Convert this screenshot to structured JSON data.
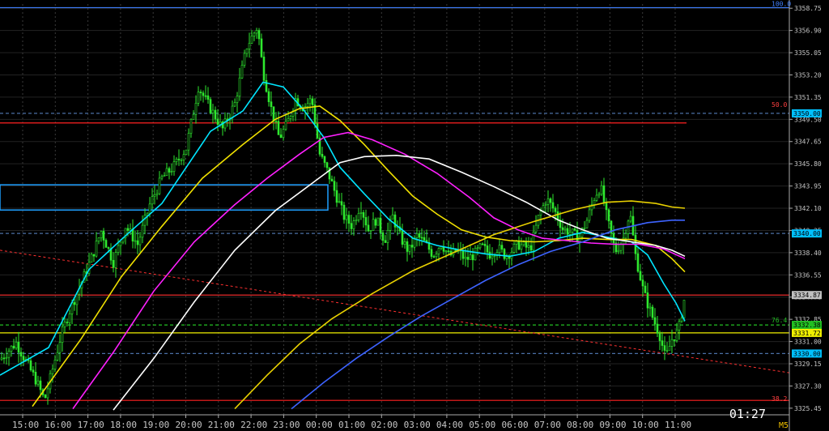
{
  "chart_data": {
    "type": "candlestick-line",
    "title": "",
    "timeframe": "M5",
    "countdown": "01:27",
    "y_ticks": [
      "3358.75",
      "3356.90",
      "3355.05",
      "3353.20",
      "3351.35",
      "3349.50",
      "3347.65",
      "3345.80",
      "3343.95",
      "3342.10",
      "3340.25",
      "3338.40",
      "3336.55",
      "3334.70",
      "3332.85",
      "3331.00",
      "3329.15",
      "3327.30",
      "3325.45"
    ],
    "x_ticks": [
      "15:00",
      "16:00",
      "17:00",
      "18:00",
      "19:00",
      "20:00",
      "21:00",
      "22:00",
      "23:00",
      "00:00",
      "01:00",
      "02:00",
      "03:00",
      "04:00",
      "05:00",
      "06:00",
      "07:00",
      "08:00",
      "09:00",
      "10:00",
      "11:00"
    ],
    "ylim": [
      3324.9,
      3359.1
    ],
    "price_tags": [
      {
        "text": "3350.00",
        "price": 3350.0,
        "bg": "#00c0ff",
        "fg": "#000000"
      },
      {
        "text": "3340.00",
        "price": 3340.0,
        "bg": "#00c0ff",
        "fg": "#000000"
      },
      {
        "text": "3334.87",
        "price": 3334.87,
        "bg": "#c0c0c0",
        "fg": "#000000"
      },
      {
        "text": "3332.38",
        "price": 3332.38,
        "bg": "#22c022",
        "fg": "#000000"
      },
      {
        "text": "3331.72",
        "price": 3331.72,
        "bg": "#f0f000",
        "fg": "#000000"
      },
      {
        "text": "3330.00",
        "price": 3330.0,
        "bg": "#00c0ff",
        "fg": "#000000"
      }
    ],
    "fib_labels": [
      {
        "text": "100.0",
        "price": 3358.8,
        "color": "#4080ff"
      },
      {
        "text": "50.0",
        "price": 3350.4,
        "color": "#ff4040"
      },
      {
        "text": "76.4",
        "price": 3332.45,
        "color": "#22c022"
      },
      {
        "text": "38.2",
        "price": 3325.9,
        "color": "#ff4040"
      }
    ],
    "levels": [
      {
        "price": 3358.8,
        "color": "#4080ff",
        "style": "solid",
        "x1": 0,
        "x2": 975
      },
      {
        "price": 3350.0,
        "color": "#4a6fa5",
        "style": "dash",
        "x1": 0,
        "x2": 975
      },
      {
        "price": 3349.2,
        "color": "#ff2020",
        "style": "solid",
        "x1": 0,
        "x2": 848
      },
      {
        "price": 3340.0,
        "color": "#4a6fa5",
        "style": "dash",
        "x1": 0,
        "x2": 975
      },
      {
        "price": 3334.87,
        "color": "#ff3030",
        "style": "solid",
        "x1": 0,
        "x2": 975
      },
      {
        "price": 3332.38,
        "color": "#22c022",
        "style": "dash",
        "x1": 0,
        "x2": 975
      },
      {
        "price": 3331.72,
        "color": "#f0f000",
        "style": "solid",
        "x1": 0,
        "x2": 975
      },
      {
        "price": 3330.0,
        "color": "#4a6fa5",
        "style": "dash",
        "x1": 0,
        "x2": 975
      },
      {
        "price": 3326.1,
        "color": "#ff2020",
        "style": "solid",
        "x1": 0,
        "x2": 975
      }
    ],
    "zones": [
      {
        "top": 3344.05,
        "bottom": 3341.95,
        "x2": 405,
        "color": "#1ea0ff"
      }
    ],
    "series": [
      {
        "color": "#00e5ff",
        "points": [
          [
            0,
            3328.2
          ],
          [
            60,
            3330.5
          ],
          [
            110,
            3337
          ],
          [
            150,
            3339.5
          ],
          [
            200,
            3342.5
          ],
          [
            260,
            3348.5
          ],
          [
            300,
            3350.2
          ],
          [
            325,
            3352.6
          ],
          [
            350,
            3352.2
          ],
          [
            375,
            3350.3
          ],
          [
            400,
            3348
          ],
          [
            420,
            3345.5
          ],
          [
            450,
            3343.3
          ],
          [
            480,
            3341.2
          ],
          [
            510,
            3339.6
          ],
          [
            540,
            3339
          ],
          [
            570,
            3338.6
          ],
          [
            600,
            3338.3
          ],
          [
            630,
            3338.1
          ],
          [
            660,
            3338.5
          ],
          [
            690,
            3339.6
          ],
          [
            720,
            3340.1
          ],
          [
            750,
            3339.7
          ],
          [
            780,
            3339.3
          ],
          [
            800,
            3338.2
          ],
          [
            820,
            3335.8
          ],
          [
            835,
            3334.2
          ],
          [
            846,
            3332.7
          ]
        ]
      },
      {
        "color": "#f0e000",
        "points": [
          [
            40,
            3325.6
          ],
          [
            100,
            3331.2
          ],
          [
            150,
            3336.4
          ],
          [
            200,
            3340.6
          ],
          [
            250,
            3344.6
          ],
          [
            300,
            3347.4
          ],
          [
            340,
            3349.5
          ],
          [
            370,
            3350.4
          ],
          [
            395,
            3350.6
          ],
          [
            420,
            3349.4
          ],
          [
            450,
            3347.4
          ],
          [
            480,
            3345.2
          ],
          [
            510,
            3343.1
          ],
          [
            540,
            3341.6
          ],
          [
            570,
            3340.3
          ],
          [
            600,
            3339.7
          ],
          [
            630,
            3339.4
          ],
          [
            660,
            3339.3
          ],
          [
            690,
            3339.4
          ],
          [
            720,
            3339.6
          ],
          [
            750,
            3339.5
          ],
          [
            780,
            3339.5
          ],
          [
            810,
            3339
          ],
          [
            830,
            3337.9
          ],
          [
            846,
            3336.8
          ]
        ]
      },
      {
        "color": "#ff20ff",
        "points": [
          [
            90,
            3325.4
          ],
          [
            140,
            3330.1
          ],
          [
            190,
            3335.2
          ],
          [
            240,
            3339.3
          ],
          [
            290,
            3342.4
          ],
          [
            330,
            3344.6
          ],
          [
            370,
            3346.6
          ],
          [
            400,
            3348
          ],
          [
            430,
            3348.4
          ],
          [
            460,
            3347.8
          ],
          [
            500,
            3346.6
          ],
          [
            540,
            3345
          ],
          [
            580,
            3343
          ],
          [
            610,
            3341.3
          ],
          [
            640,
            3340.3
          ],
          [
            670,
            3339.6
          ],
          [
            700,
            3339.4
          ],
          [
            730,
            3339.2
          ],
          [
            760,
            3339.1
          ],
          [
            790,
            3339.1
          ],
          [
            820,
            3338.7
          ],
          [
            846,
            3337.9
          ]
        ]
      },
      {
        "color": "#ffffff",
        "points": [
          [
            140,
            3325.3
          ],
          [
            190,
            3329.6
          ],
          [
            240,
            3334.3
          ],
          [
            290,
            3338.6
          ],
          [
            340,
            3341.9
          ],
          [
            390,
            3344.4
          ],
          [
            420,
            3345.9
          ],
          [
            450,
            3346.4
          ],
          [
            490,
            3346.5
          ],
          [
            530,
            3346.2
          ],
          [
            570,
            3345.1
          ],
          [
            610,
            3343.9
          ],
          [
            650,
            3342.6
          ],
          [
            690,
            3341.1
          ],
          [
            720,
            3340.3
          ],
          [
            750,
            3339.6
          ],
          [
            780,
            3339.3
          ],
          [
            810,
            3339
          ],
          [
            830,
            3338.6
          ],
          [
            846,
            3338.1
          ]
        ]
      },
      {
        "color": "#e8d000",
        "points": [
          [
            290,
            3325.4
          ],
          [
            330,
            3328.2
          ],
          [
            370,
            3330.8
          ],
          [
            410,
            3332.9
          ],
          [
            460,
            3335
          ],
          [
            510,
            3336.9
          ],
          [
            560,
            3338.4
          ],
          [
            610,
            3339.9
          ],
          [
            660,
            3341
          ],
          [
            710,
            3342
          ],
          [
            750,
            3342.6
          ],
          [
            780,
            3342.7
          ],
          [
            810,
            3342.5
          ],
          [
            830,
            3342.2
          ],
          [
            846,
            3342.1
          ]
        ]
      },
      {
        "color": "#3d63ff",
        "points": [
          [
            360,
            3325.4
          ],
          [
            400,
            3327.6
          ],
          [
            440,
            3329.6
          ],
          [
            480,
            3331.4
          ],
          [
            520,
            3333.1
          ],
          [
            560,
            3334.6
          ],
          [
            600,
            3336.1
          ],
          [
            640,
            3337.4
          ],
          [
            680,
            3338.5
          ],
          [
            720,
            3339.3
          ],
          [
            760,
            3340.3
          ],
          [
            800,
            3340.9
          ],
          [
            830,
            3341.1
          ],
          [
            846,
            3341.1
          ]
        ]
      }
    ],
    "trendline": {
      "color": "#ff3030",
      "from": [
        0,
        3338.6
      ],
      "to": [
        975,
        3328.4
      ]
    },
    "price_path": [
      [
        0,
        3329.5
      ],
      [
        20,
        3330.9
      ],
      [
        30,
        3329.6
      ],
      [
        45,
        3327.7
      ],
      [
        55,
        3326.1
      ],
      [
        65,
        3328.7
      ],
      [
        75,
        3331.4
      ],
      [
        85,
        3333.4
      ],
      [
        100,
        3335.8
      ],
      [
        115,
        3338.3
      ],
      [
        125,
        3340.2
      ],
      [
        140,
        3337.6
      ],
      [
        155,
        3340.6
      ],
      [
        170,
        3339.1
      ],
      [
        185,
        3342.4
      ],
      [
        200,
        3344.6
      ],
      [
        215,
        3345.6
      ],
      [
        230,
        3347.1
      ],
      [
        245,
        3352.2
      ],
      [
        260,
        3350.4
      ],
      [
        275,
        3348.7
      ],
      [
        290,
        3350.8
      ],
      [
        305,
        3355.6
      ],
      [
        318,
        3357.2
      ],
      [
        325,
        3353.5
      ],
      [
        335,
        3350.4
      ],
      [
        345,
        3347.9
      ],
      [
        355,
        3349.2
      ],
      [
        365,
        3351.2
      ],
      [
        375,
        3350.5
      ],
      [
        385,
        3351.2
      ],
      [
        395,
        3346.6
      ],
      [
        405,
        3345.1
      ],
      [
        415,
        3343.2
      ],
      [
        425,
        3341.4
      ],
      [
        435,
        3340.6
      ],
      [
        445,
        3342.4
      ],
      [
        455,
        3340.3
      ],
      [
        465,
        3341.2
      ],
      [
        475,
        3339.4
      ],
      [
        485,
        3341.4
      ],
      [
        495,
        3339.6
      ],
      [
        505,
        3338.5
      ],
      [
        515,
        3339.8
      ],
      [
        525,
        3339.2
      ],
      [
        535,
        3338.2
      ],
      [
        545,
        3339.2
      ],
      [
        555,
        3338.1
      ],
      [
        565,
        3338.6
      ],
      [
        575,
        3337.8
      ],
      [
        585,
        3338.2
      ],
      [
        595,
        3338.9
      ],
      [
        605,
        3338.3
      ],
      [
        615,
        3338.8
      ],
      [
        625,
        3338.1
      ],
      [
        640,
        3339.1
      ],
      [
        655,
        3338.7
      ],
      [
        665,
        3341.3
      ],
      [
        675,
        3342.9
      ],
      [
        685,
        3341.9
      ],
      [
        695,
        3340.4
      ],
      [
        705,
        3340.1
      ],
      [
        715,
        3339.6
      ],
      [
        725,
        3341.1
      ],
      [
        735,
        3343.2
      ],
      [
        742,
        3343.9
      ],
      [
        750,
        3341.2
      ],
      [
        760,
        3338.5
      ],
      [
        770,
        3339.6
      ],
      [
        778,
        3341.8
      ],
      [
        785,
        3338.2
      ],
      [
        795,
        3335.1
      ],
      [
        805,
        3333.2
      ],
      [
        815,
        3331.5
      ],
      [
        822,
        3329.6
      ],
      [
        830,
        3331.2
      ],
      [
        838,
        3331.9
      ],
      [
        846,
        3334.8
      ]
    ]
  }
}
